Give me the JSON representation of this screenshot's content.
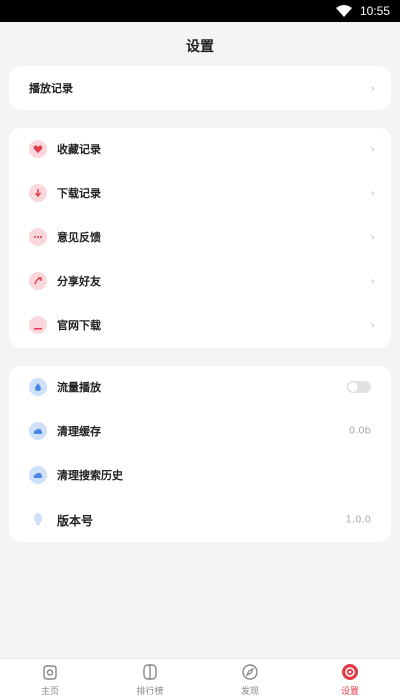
{
  "status_bar": {
    "time": "10:55"
  },
  "header": {
    "title": "设置"
  },
  "card1": {
    "items": [
      {
        "label": "播放记录"
      }
    ]
  },
  "card2": {
    "items": [
      {
        "label": "收藏记录",
        "icon": "heart-icon"
      },
      {
        "label": "下载记录",
        "icon": "download-icon"
      },
      {
        "label": "意见反馈",
        "icon": "feedback-icon"
      },
      {
        "label": "分享好友",
        "icon": "share-icon"
      },
      {
        "label": "官网下载",
        "icon": "website-icon"
      }
    ]
  },
  "card3": {
    "items": [
      {
        "label": "流量播放",
        "icon": "water-drop-icon",
        "toggle": false
      },
      {
        "label": "清理缓存",
        "icon": "cloud-icon",
        "value": "0.0b"
      },
      {
        "label": "清理搜索历史",
        "icon": "cloud-icon"
      },
      {
        "label": "版本号",
        "icon": "bulb-icon",
        "value": "1.0.0"
      }
    ]
  },
  "tabbar": {
    "tabs": [
      {
        "label": "主页",
        "icon": "home-icon",
        "active": false
      },
      {
        "label": "排行榜",
        "icon": "ranking-icon",
        "active": false
      },
      {
        "label": "发现",
        "icon": "compass-icon",
        "active": false
      },
      {
        "label": "设置",
        "icon": "settings-icon",
        "active": true
      }
    ]
  },
  "colors": {
    "accent": "#e23b4a",
    "red_icon_bg": "#f9d7dc",
    "blue_icon_bg": "#cfe0fb",
    "page_bg": "#f4f4f4"
  }
}
